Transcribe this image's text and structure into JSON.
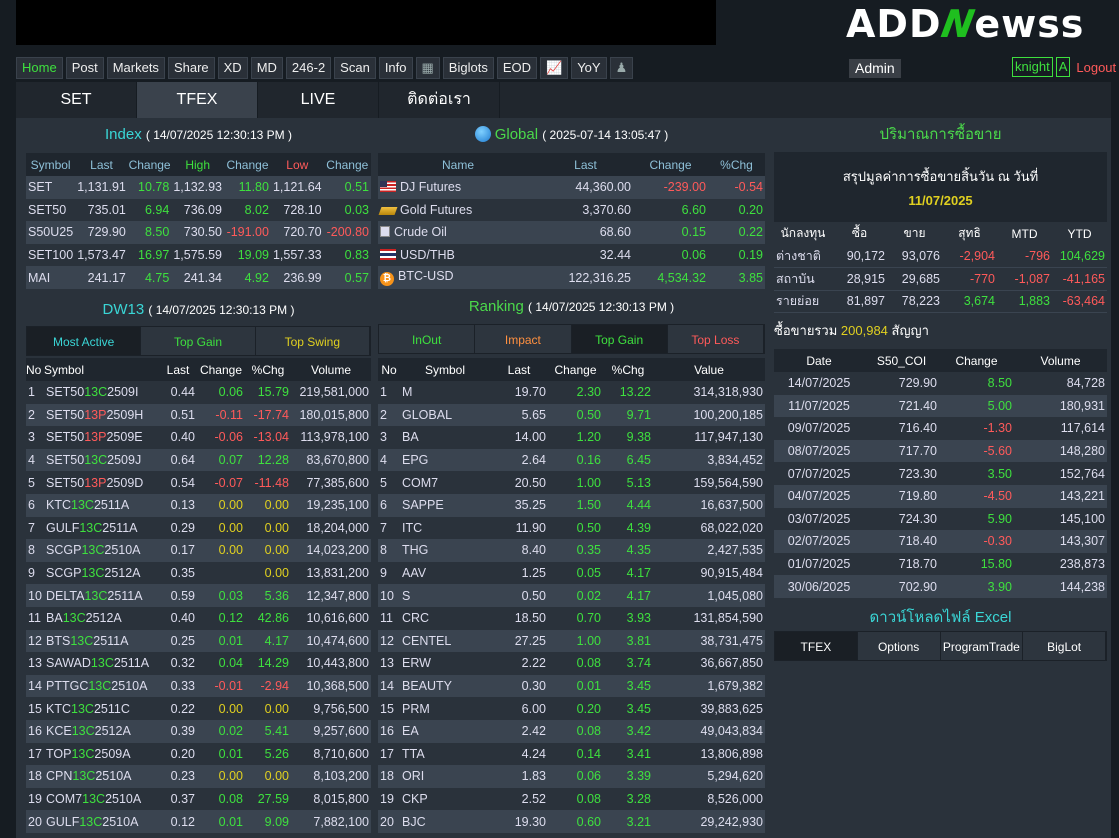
{
  "brand": {
    "logo_a": "ADD",
    "logo_n": "N",
    "logo_b": "ewss"
  },
  "menu": [
    "Home",
    "Post",
    "Markets",
    "Share",
    "XD",
    "MD",
    "246-2",
    "Scan",
    "Info",
    "calendar-icon",
    "Biglots",
    "EOD",
    "chart-icon",
    "YoY",
    "person-icon"
  ],
  "admin": "Admin",
  "user": {
    "name": "knight",
    "badge": "A",
    "logout": "Logout"
  },
  "tabs": [
    "SET",
    "TFEX",
    "LIVE",
    "ติดต่อเรา"
  ],
  "index": {
    "title": "Index",
    "date": "( 14/07/2025 12:30:13 PM )",
    "headers": [
      "Symbol",
      "Last",
      "Change",
      "High",
      "Change",
      "Low",
      "Change"
    ],
    "rows": [
      [
        "SET",
        "1,131.91",
        "10.78",
        "1,132.93",
        "11.80",
        "1,121.64",
        "0.51"
      ],
      [
        "SET50",
        "735.01",
        "6.94",
        "736.09",
        "8.02",
        "728.10",
        "0.03"
      ],
      [
        "S50U25",
        "729.90",
        "8.50",
        "730.50",
        "-191.00",
        "720.70",
        "-200.80"
      ],
      [
        "SET100",
        "1,573.47",
        "16.97",
        "1,575.59",
        "19.09",
        "1,557.33",
        "0.83"
      ],
      [
        "MAI",
        "241.17",
        "4.75",
        "241.34",
        "4.92",
        "236.99",
        "0.57"
      ]
    ]
  },
  "global": {
    "title": "Global",
    "date": "( 2025-07-14 13:05:47 )",
    "headers": [
      "Name",
      "Last",
      "Change",
      "%Chg"
    ],
    "rows": [
      [
        "DJ Futures",
        "44,360.00",
        "-239.00",
        "-0.54"
      ],
      [
        "Gold Futures",
        "3,370.60",
        "6.60",
        "0.20"
      ],
      [
        "Crude Oil",
        "68.60",
        "0.15",
        "0.22"
      ],
      [
        "USD/THB",
        "32.44",
        "0.06",
        "0.19"
      ],
      [
        "BTC-USD",
        "122,316.25",
        "4,534.32",
        "3.85"
      ]
    ]
  },
  "dw": {
    "title": "DW13",
    "date": "( 14/07/2025 12:30:13 PM )",
    "buttons": [
      "Most Active",
      "Top Gain",
      "Top Swing"
    ],
    "headers": [
      "No",
      "Symbol",
      "Last",
      "Change",
      "%Chg",
      "Volume"
    ],
    "rows": [
      [
        "1",
        "SET50",
        "13C",
        "2509I",
        "0.44",
        "0.06",
        "15.79",
        "219,581,000"
      ],
      [
        "2",
        "SET50",
        "13P",
        "2509H",
        "0.51",
        "-0.11",
        "-17.74",
        "180,015,800"
      ],
      [
        "3",
        "SET50",
        "13P",
        "2509E",
        "0.40",
        "-0.06",
        "-13.04",
        "113,978,100"
      ],
      [
        "4",
        "SET50",
        "13C",
        "2509J",
        "0.64",
        "0.07",
        "12.28",
        "83,670,800"
      ],
      [
        "5",
        "SET50",
        "13P",
        "2509D",
        "0.54",
        "-0.07",
        "-11.48",
        "77,385,600"
      ],
      [
        "6",
        "KTC",
        "13C",
        "2511A",
        "0.13",
        "0.00",
        "0.00",
        "19,235,100"
      ],
      [
        "7",
        "GULF",
        "13C",
        "2511A",
        "0.29",
        "0.00",
        "0.00",
        "18,204,000"
      ],
      [
        "8",
        "SCGP",
        "13C",
        "2510A",
        "0.17",
        "0.00",
        "0.00",
        "14,023,200"
      ],
      [
        "9",
        "SCGP",
        "13C",
        "2512A",
        "0.35",
        "",
        "0.00",
        "13,831,200"
      ],
      [
        "10",
        "DELTA",
        "13C",
        "2511A",
        "0.59",
        "0.03",
        "5.36",
        "12,347,800"
      ],
      [
        "11",
        "BA",
        "13C",
        "2512A",
        "0.40",
        "0.12",
        "42.86",
        "10,616,600"
      ],
      [
        "12",
        "BTS",
        "13C",
        "2511A",
        "0.25",
        "0.01",
        "4.17",
        "10,474,600"
      ],
      [
        "13",
        "SAWAD",
        "13C",
        "2511A",
        "0.32",
        "0.04",
        "14.29",
        "10,443,800"
      ],
      [
        "14",
        "PTTGC",
        "13C",
        "2510A",
        "0.33",
        "-0.01",
        "-2.94",
        "10,368,500"
      ],
      [
        "15",
        "KTC",
        "13C",
        "2511C",
        "0.22",
        "0.00",
        "0.00",
        "9,756,500"
      ],
      [
        "16",
        "KCE",
        "13C",
        "2512A",
        "0.39",
        "0.02",
        "5.41",
        "9,257,600"
      ],
      [
        "17",
        "TOP",
        "13C",
        "2509A",
        "0.20",
        "0.01",
        "5.26",
        "8,710,600"
      ],
      [
        "18",
        "CPN",
        "13C",
        "2510A",
        "0.23",
        "0.00",
        "0.00",
        "8,103,200"
      ],
      [
        "19",
        "COM7",
        "13C",
        "2510A",
        "0.37",
        "0.08",
        "27.59",
        "8,015,800"
      ],
      [
        "20",
        "GULF",
        "13C",
        "2510A",
        "0.12",
        "0.01",
        "9.09",
        "7,882,100"
      ]
    ]
  },
  "ranking": {
    "title": "Ranking",
    "date": "( 14/07/2025 12:30:13 PM )",
    "buttons": [
      "InOut",
      "Impact",
      "Top Gain",
      "Top Loss"
    ],
    "headers": [
      "No",
      "Symbol",
      "Last",
      "Change",
      "%Chg",
      "Value"
    ],
    "rows": [
      [
        "1",
        "M",
        "19.70",
        "2.30",
        "13.22",
        "314,318,930"
      ],
      [
        "2",
        "GLOBAL",
        "5.65",
        "0.50",
        "9.71",
        "100,200,185"
      ],
      [
        "3",
        "BA",
        "14.00",
        "1.20",
        "9.38",
        "117,947,130"
      ],
      [
        "4",
        "EPG",
        "2.64",
        "0.16",
        "6.45",
        "3,834,452"
      ],
      [
        "5",
        "COM7",
        "20.50",
        "1.00",
        "5.13",
        "159,564,590"
      ],
      [
        "6",
        "SAPPE",
        "35.25",
        "1.50",
        "4.44",
        "16,637,500"
      ],
      [
        "7",
        "ITC",
        "11.90",
        "0.50",
        "4.39",
        "68,022,020"
      ],
      [
        "8",
        "THG",
        "8.40",
        "0.35",
        "4.35",
        "2,427,535"
      ],
      [
        "9",
        "AAV",
        "1.25",
        "0.05",
        "4.17",
        "90,915,484"
      ],
      [
        "10",
        "S",
        "0.50",
        "0.02",
        "4.17",
        "1,045,080"
      ],
      [
        "11",
        "CRC",
        "18.50",
        "0.70",
        "3.93",
        "131,854,590"
      ],
      [
        "12",
        "CENTEL",
        "27.25",
        "1.00",
        "3.81",
        "38,731,475"
      ],
      [
        "13",
        "ERW",
        "2.22",
        "0.08",
        "3.74",
        "36,667,850"
      ],
      [
        "14",
        "BEAUTY",
        "0.30",
        "0.01",
        "3.45",
        "1,679,382"
      ],
      [
        "15",
        "PRM",
        "6.00",
        "0.20",
        "3.45",
        "39,883,625"
      ],
      [
        "16",
        "EA",
        "2.42",
        "0.08",
        "3.42",
        "49,043,834"
      ],
      [
        "17",
        "TTA",
        "4.24",
        "0.14",
        "3.41",
        "13,806,898"
      ],
      [
        "18",
        "ORI",
        "1.83",
        "0.06",
        "3.39",
        "5,294,620"
      ],
      [
        "19",
        "CKP",
        "2.52",
        "0.08",
        "3.28",
        "8,526,000"
      ],
      [
        "20",
        "BJC",
        "19.30",
        "0.60",
        "3.21",
        "29,242,930"
      ]
    ]
  },
  "volume": {
    "title": "ปริมาณการซื้อขาย",
    "summary": "สรุปมูลค่าการซื้อขายสิ้นวัน ณ วันที่",
    "summary_date": "11/07/2025",
    "headers": [
      "นักลงทุน",
      "ซื้อ",
      "ขาย",
      "สุทธิ",
      "MTD",
      "YTD"
    ],
    "rows": [
      [
        "ต่างชาติ",
        "90,172",
        "93,076",
        "-2,904",
        "-796",
        "104,629"
      ],
      [
        "สถาบัน",
        "28,915",
        "29,685",
        "-770",
        "-1,087",
        "-41,165"
      ],
      [
        "รายย่อย",
        "81,897",
        "78,223",
        "3,674",
        "1,883",
        "-63,464"
      ]
    ],
    "total_label": "ซื้อขายรวม",
    "total": "200,984",
    "total_unit": "สัญญา",
    "hist_headers": [
      "Date",
      "S50_COI",
      "Change",
      "Volume"
    ],
    "hist": [
      [
        "14/07/2025",
        "729.90",
        "8.50",
        "84,728"
      ],
      [
        "11/07/2025",
        "721.40",
        "5.00",
        "180,931"
      ],
      [
        "09/07/2025",
        "716.40",
        "-1.30",
        "117,614"
      ],
      [
        "08/07/2025",
        "717.70",
        "-5.60",
        "148,280"
      ],
      [
        "07/07/2025",
        "723.30",
        "3.50",
        "152,764"
      ],
      [
        "04/07/2025",
        "719.80",
        "-4.50",
        "143,221"
      ],
      [
        "03/07/2025",
        "724.30",
        "5.90",
        "145,100"
      ],
      [
        "02/07/2025",
        "718.40",
        "-0.30",
        "143,307"
      ],
      [
        "01/07/2025",
        "718.70",
        "15.80",
        "238,873"
      ],
      [
        "30/06/2025",
        "702.90",
        "3.90",
        "144,238"
      ]
    ],
    "download_title": "ดาวน์โหลดไฟล์ Excel",
    "download_buttons": [
      "TFEX",
      "Options",
      "ProgramTrade",
      "BigLot"
    ]
  }
}
